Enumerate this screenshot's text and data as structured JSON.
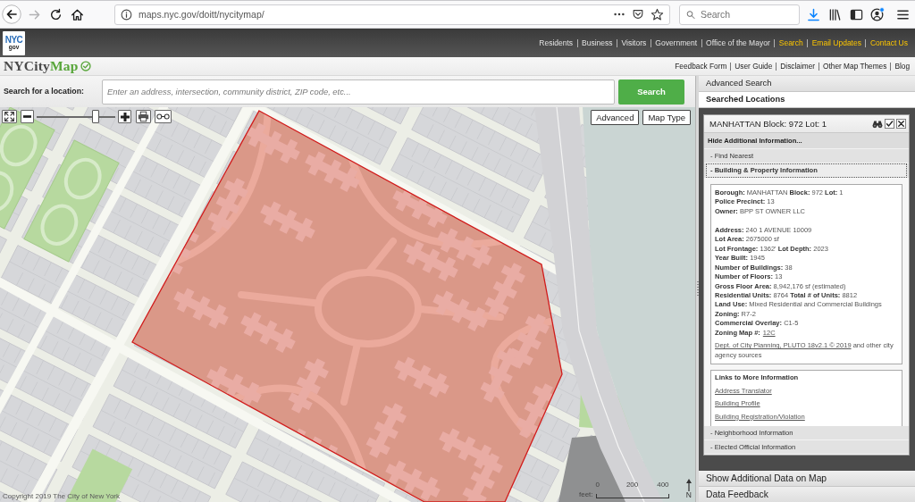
{
  "browser": {
    "nav_buttons": [
      {
        "kind": "back",
        "disabled": false
      },
      {
        "kind": "forward",
        "disabled": true
      },
      {
        "kind": "reload",
        "disabled": false
      },
      {
        "kind": "home",
        "disabled": false
      }
    ],
    "url": "maps.nyc.gov/doitt/nycitymap/",
    "search": {
      "placeholder": "Search"
    },
    "tools": [
      {
        "kind": "download"
      },
      {
        "kind": "library"
      },
      {
        "kind": "sidebar"
      },
      {
        "kind": "account"
      },
      {
        "kind": "menu"
      }
    ]
  },
  "site_header": {
    "logo": {
      "text": "NYC",
      "sub": "gov"
    },
    "links": [
      {
        "label": "Residents",
        "kind": "section"
      },
      {
        "label": "Business",
        "kind": "section"
      },
      {
        "label": "Visitors",
        "kind": "section"
      },
      {
        "label": "Government",
        "kind": "section"
      },
      {
        "label": "Office of the Mayor",
        "kind": "section"
      },
      {
        "label": "Search",
        "kind": "utility"
      },
      {
        "label": "Email Updates",
        "kind": "utility"
      },
      {
        "label": "Contact Us",
        "kind": "utility"
      }
    ]
  },
  "app_header": {
    "logo": {
      "text": "NYCity",
      "accent": "Map"
    },
    "links": [
      "Feedback Form",
      "User Guide",
      "Disclaimer",
      "Other Map Themes",
      "Blog"
    ]
  },
  "search": {
    "label": "Search for a location:",
    "placeholder": "Enter an address, intersection, community district, ZIP code, etc...",
    "button": "Search"
  },
  "map": {
    "tools": [
      {
        "kind": "fullscreen"
      },
      {
        "kind": "zoom-out"
      },
      {
        "kind": "zoom-slider",
        "level": 0.78
      },
      {
        "kind": "zoom-in"
      },
      {
        "kind": "print"
      },
      {
        "kind": "link"
      }
    ],
    "buttons": [
      "Advanced",
      "Map Type"
    ],
    "copyright": "Copyright 2019 The City of New York",
    "scale": {
      "unit": "feet:",
      "ticks": [
        "0",
        "200",
        "400"
      ]
    },
    "north": "N"
  },
  "panels": [
    {
      "label": "Advanced Search",
      "selected": false
    },
    {
      "label": "Searched Locations",
      "selected": true
    },
    {
      "label": "Show Additional Data on Map",
      "selected": false
    },
    {
      "label": "Data Feedback",
      "selected": false
    }
  ],
  "result": {
    "title": "MANHATTAN Block: 972 Lot: 1",
    "checked": true,
    "toggle": "Hide Additional Information...",
    "sections": [
      {
        "label": "- Find Nearest",
        "expanded": false
      },
      {
        "label": "- Building & Property Information",
        "expanded": true
      },
      {
        "label": "- Neighborhood Information",
        "expanded": false
      },
      {
        "label": "- Elected Official Information",
        "expanded": false
      }
    ],
    "property": {
      "groups": [
        [
          {
            "text": "**Borough:** MANHATTAN **Block:** 972 **Lot:** 1"
          },
          {
            "text": "**Police Precinct:** 13"
          },
          {
            "text": "**Owner:** BPP ST OWNER LLC"
          }
        ],
        [
          {
            "text": "**Address:** 240 1 AVENUE 10009"
          },
          {
            "text": "**Lot Area:** 2675000 sf"
          },
          {
            "text": "**Lot Frontage:** 1362' **Lot Depth:** 2023"
          },
          {
            "text": "**Year Built:** 1945"
          },
          {
            "text": "**Number of Buildings:** 38"
          },
          {
            "text": "**Number of Floors:** 13"
          },
          {
            "text": "**Gross Floor Area:** 8,942,176 sf (estimated)"
          },
          {
            "text": "**Residential Units:** 8764 **Total # of Units:** 8812"
          },
          {
            "text": "**Land Use:** Mixed Residential and Commercial Buildings"
          },
          {
            "text": "**Zoning:** R7-2"
          },
          {
            "text": "**Commercial Overlay:** C1-5"
          },
          {
            "label": "Zoning Map #:",
            "link": "12C"
          }
        ]
      ],
      "source": {
        "link": "Dept. of City Planning, PLUTO 18v2.1 © 2019",
        "text": " and other city agency sources"
      }
    },
    "links": {
      "title": "Links to More Information",
      "items": [
        "Address Translator",
        "Building Profile",
        "Building Registration/Violation"
      ]
    }
  }
}
